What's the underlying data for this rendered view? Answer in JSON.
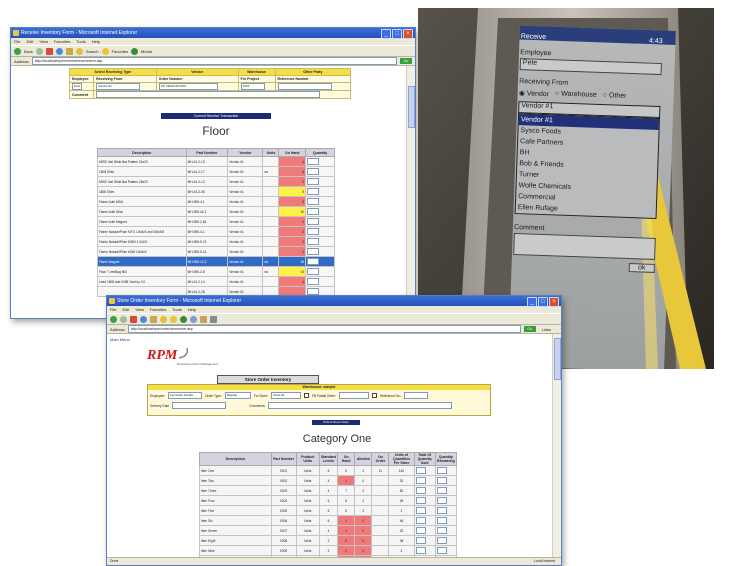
{
  "floor_window": {
    "title": "Receive Inventory Form - Microsoft Internet Explorer",
    "menu": [
      "File",
      "Edit",
      "View",
      "Favorites",
      "Tools",
      "Help"
    ],
    "toolbar": {
      "back": "Back",
      "search": "Search",
      "favorites": "Favorites",
      "media": "Media"
    },
    "address_label": "Address",
    "address": "http://localhost/rpm/receive/receiveform.asp",
    "go": "Go",
    "header": {
      "row1": [
        "Select Receiving Type",
        "Vendor",
        "Warehouse",
        "Other Party"
      ],
      "employee_label": "Employee",
      "employee_value": "Pete",
      "receiving_from_label": "Receiving From",
      "receiving_from_value": "Vendor #1",
      "order_number_label": "Order Number",
      "order_number_value": "PO VENDOR 0001",
      "for_project_label": "For Project",
      "for_project_value": "1010",
      "reference_label": "Reference Number",
      "comment_label": "Comment"
    },
    "commit_button": "Commit Receive Transaction",
    "section_title": "Floor",
    "table": {
      "columns": [
        "Description",
        "Part Number",
        "Vendor",
        "Units",
        "On Hand",
        "Quantity"
      ],
      "rows": [
        {
          "d": "MISE Vari Wide Bat Pattern 24x20",
          "p": "MH-44-2-13",
          "v": "Vendor #1",
          "u": "",
          "h": "4",
          "hc": "red"
        },
        {
          "d": "1808 Shim",
          "p": "MH-44-2-17",
          "v": "Vendor #1",
          "u": "ea",
          "h": "6",
          "hc": "red"
        },
        {
          "d": "MISE Vari Wide Bat Pattern 28x20",
          "p": "MH-44-2-13",
          "v": "Vendor #1",
          "u": "",
          "h": "2",
          "hc": "red"
        },
        {
          "d": "1808 Shim",
          "p": "MH-44-2-08",
          "v": "Vendor #1",
          "u": "",
          "h": "9",
          "hc": "yel"
        },
        {
          "d": "Flame Auth MDA",
          "p": "MH-955-4-1",
          "v": "Vendor #1",
          "u": "",
          "h": "8",
          "hc": "red"
        },
        {
          "d": "Flame Auth Stick",
          "p": "MH-955-44-1",
          "v": "Vendor #1",
          "u": "",
          "h": "10",
          "hc": "yel"
        },
        {
          "d": "Flame Auth Magnet",
          "p": "MH-955-2-84",
          "v": "Vendor #1",
          "u": "",
          "h": "4",
          "hc": "red"
        },
        {
          "d": "Flame Natural/Plum MTO 1/4x6/4 and 3/8x3/8",
          "p": "MH-955-4-1",
          "v": "Vendor #1",
          "u": "",
          "h": "6",
          "hc": "red"
        },
        {
          "d": "Flame Natural/Plum MDM 1.0x2/3",
          "p": "MH-955-5-74",
          "v": "Vendor #1",
          "u": "",
          "h": "2",
          "hc": "red"
        },
        {
          "d": "Flame Natural/Plum M0M 1/8x6/4",
          "p": "MH-955-5-14",
          "v": "Vendor #1",
          "u": "",
          "h": "2",
          "hc": "red"
        },
        {
          "d": "Flame Magnet",
          "p": "MH-955-13-3",
          "v": "Vendor #1",
          "u": "ea",
          "h": "45",
          "hc": "sel"
        },
        {
          "d": "Floor T vertBag 800",
          "p": "MH-955-2-8",
          "v": "Vendor #1",
          "u": "ea",
          "h": "10",
          "hc": "yel"
        },
        {
          "d": "Lead 1808 and 0408 Yard by 3.0",
          "p": "MH-44-2-14",
          "v": "Vendor #1",
          "u": "",
          "h": "4",
          "hc": "red"
        },
        {
          "d": "",
          "p": "MH-44-2-28",
          "v": "Vendor #1",
          "u": "",
          "h": "",
          "hc": "red"
        }
      ]
    }
  },
  "category_window": {
    "title": "Store Order Inventory Form - Microsoft Internet Explorer",
    "menu": [
      "File",
      "Edit",
      "View",
      "Favorites",
      "Tools",
      "Help"
    ],
    "address_label": "Address",
    "address": "http://localhost/rpm/order/storeorder.asp",
    "go": "Go",
    "links": "Links",
    "main_menu": "Main Menu",
    "logo_text": "RPM",
    "logo_sub": "Restaurant Parts Management",
    "form_title": "Store Order Inventory",
    "header": {
      "band_title": "Warehouse: sample",
      "employee_label": "Employee:",
      "employee_value": "Fernando Zavala",
      "order_type_label": "Order Type:",
      "order_type_value": "Regular",
      "for_store_label": "For Store:",
      "for_store_value": "Store #1",
      "fill_partial_label": "Fill Partial Order:",
      "fill_partial_value": "",
      "reference_label": "Reference No.:",
      "delivery_label": "Delivery Date",
      "comments_label": "Comments:"
    },
    "submit_button": "Submit Store Order",
    "section_title": "Category One",
    "table": {
      "columns": [
        "Description",
        "Part Number",
        "Product Units",
        "Standard Levels",
        "On Hand",
        "Allotted",
        "On Order",
        "Units of Quantities Per Store",
        "Total Of Quantity Sold",
        "Quantity Remaining"
      ],
      "rows": [
        {
          "d": "Item One",
          "p": "0001",
          "u": "Units",
          "s": "6",
          "h": "6",
          "a": "2",
          "o": "11",
          "q": "140"
        },
        {
          "d": "Item Two",
          "p": "0002",
          "u": "Units",
          "s": "4",
          "h": "1",
          "a": "0",
          "o": "",
          "q": "20",
          "hc": "red"
        },
        {
          "d": "Item Three",
          "p": "0003",
          "u": "Units",
          "s": "4",
          "h": "7",
          "a": "2",
          "o": "",
          "q": "82"
        },
        {
          "d": "Item Four",
          "p": "0004",
          "u": "Units",
          "s": "6",
          "h": "6",
          "a": "2",
          "o": "",
          "q": "26"
        },
        {
          "d": "Item Five",
          "p": "0005",
          "u": "Units",
          "s": "6",
          "h": "6",
          "a": "2",
          "o": "",
          "q": "1"
        },
        {
          "d": "Item Six",
          "p": "0006",
          "u": "Units",
          "s": "6",
          "h": "1",
          "a": "0",
          "o": "",
          "q": "46",
          "hc": "red",
          "ac": "red"
        },
        {
          "d": "Item Seven",
          "p": "0007",
          "u": "Units",
          "s": "4",
          "h": "1",
          "a": "0",
          "o": "",
          "q": "32",
          "hc": "red",
          "ac": "red"
        },
        {
          "d": "Item Eight",
          "p": "0008",
          "u": "Units",
          "s": "2",
          "h": "0",
          "a": "0",
          "o": "",
          "q": "38",
          "hc": "red",
          "ac": "red"
        },
        {
          "d": "Item Nine",
          "p": "0009",
          "u": "Units",
          "s": "2",
          "h": "0",
          "a": "0",
          "o": "",
          "q": "4",
          "hc": "red",
          "ac": "red"
        },
        {
          "d": "Item Ten",
          "p": "0010",
          "u": "Units",
          "s": "2",
          "h": "0",
          "a": "0",
          "o": "",
          "q": "",
          "hc": "red",
          "ac": "red"
        },
        {
          "d": "Item Eleven",
          "p": "0011",
          "u": "Units",
          "s": "2",
          "h": "0",
          "a": "0",
          "o": "",
          "q": "",
          "hc": "red",
          "ac": "red"
        }
      ]
    },
    "status": "Done",
    "status_right": "Local intranet"
  },
  "handheld": {
    "title": "Receive",
    "time": "4:43",
    "label_employee": "Employee",
    "employee_value": "Pete",
    "label_receiving": "Receiving From",
    "radio_options": [
      "Vendor",
      "Warehouse",
      "Other"
    ],
    "dropdown_value": "Vendor #1",
    "list_items": [
      "Vendor #1",
      "Sysco Foods",
      "Cafe Partners",
      "BH",
      "Bob & Friends",
      "Turner",
      "Wolfe Chemicals",
      "Commercial",
      "Ellen Rufage"
    ],
    "selected_index": 0,
    "label_comment": "Comment",
    "ok_button": "ok"
  }
}
